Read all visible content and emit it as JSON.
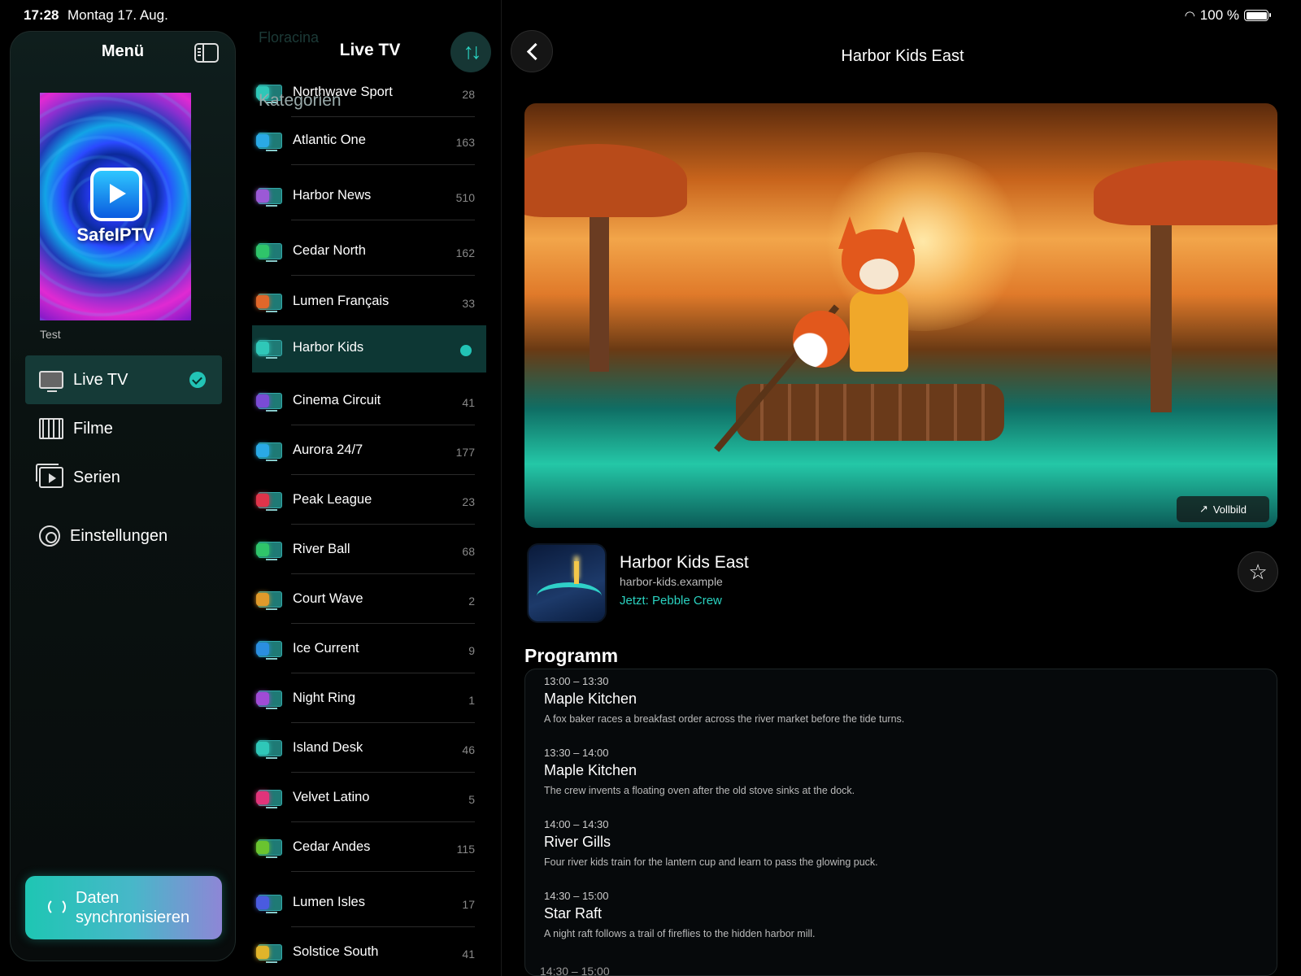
{
  "status": {
    "time": "17:28",
    "date": "Montag 17. Aug.",
    "battery": "100 %"
  },
  "sidebar": {
    "title": "Menü",
    "poster_name": "SafeIPTV",
    "profile_name": "Test",
    "items": [
      {
        "label": "Live TV",
        "active": true
      },
      {
        "label": "Filme"
      },
      {
        "label": "Serien"
      },
      {
        "label": "Einstellungen"
      }
    ],
    "sync_label_1": "Daten",
    "sync_label_2": "synchronisieren"
  },
  "channels": {
    "title": "Live TV",
    "ghost_top": "Floracina",
    "ghost_kategorien": "Kategorien",
    "items": [
      {
        "name": "Northwave Sport",
        "count": "28",
        "color": "#2fc7b8"
      },
      {
        "name": "Atlantic One",
        "count": "163",
        "color": "#2aa9e6"
      },
      {
        "name": "Harbor News",
        "count": "510",
        "color": "#9b59d6"
      },
      {
        "name": "Cedar North",
        "count": "162",
        "color": "#2fc46a"
      },
      {
        "name": "Lumen Français",
        "count": "33",
        "color": "#e0672a"
      },
      {
        "name": "Harbor Kids",
        "count": "",
        "color": "#2fc7b8",
        "selected": true
      },
      {
        "name": "Cinema Circuit",
        "count": "41",
        "color": "#7a4bd6"
      },
      {
        "name": "Aurora 24/7",
        "count": "177",
        "color": "#2aa9e6"
      },
      {
        "name": "Peak League",
        "count": "23",
        "color": "#e0344a"
      },
      {
        "name": "River Ball",
        "count": "68",
        "color": "#2fc46a"
      },
      {
        "name": "Court Wave",
        "count": "2",
        "color": "#e09a2a"
      },
      {
        "name": "Ice Current",
        "count": "9",
        "color": "#2a8ee0"
      },
      {
        "name": "Night Ring",
        "count": "1",
        "color": "#a04bd6"
      },
      {
        "name": "Island Desk",
        "count": "46",
        "color": "#2fc7b8"
      },
      {
        "name": "Velvet Latino",
        "count": "5",
        "color": "#e0347a"
      },
      {
        "name": "Cedar Andes",
        "count": "115",
        "color": "#6ac42f"
      },
      {
        "name": "Lumen Isles",
        "count": "17",
        "color": "#4a5be0"
      },
      {
        "name": "Solstice South",
        "count": "41",
        "color": "#e0b42a"
      }
    ]
  },
  "detail": {
    "title": "Harbor Kids East",
    "vollbild": "Vollbild",
    "channel_name": "Harbor Kids East",
    "channel_url": "harbor-kids.example",
    "now_playing": "Jetzt: Pebble Crew",
    "programm_heading": "Programm",
    "programs": [
      {
        "time": "13:00 – 13:30",
        "title": "Maple Kitchen",
        "desc": "A fox baker races a breakfast order across the river market before the tide turns."
      },
      {
        "time": "13:30 – 14:00",
        "title": "Maple Kitchen",
        "desc": "The crew invents a floating oven after the old stove sinks at the dock."
      },
      {
        "time": "14:00 – 14:30",
        "title": "River Gills",
        "desc": "Four river kids train for the lantern cup and learn to pass the glowing puck."
      },
      {
        "time": "14:30 – 15:00",
        "title": "Star Raft",
        "desc": "A night raft follows a trail of fireflies to the hidden harbor mill."
      }
    ],
    "next_ghost_time": "14:30 – 15:00"
  }
}
